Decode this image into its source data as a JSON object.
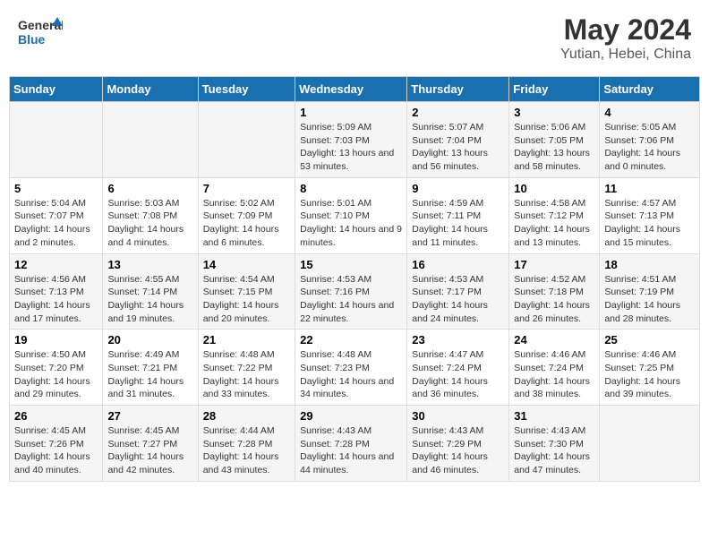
{
  "header": {
    "logo_line1": "General",
    "logo_line2": "Blue",
    "month_year": "May 2024",
    "location": "Yutian, Hebei, China"
  },
  "weekdays": [
    "Sunday",
    "Monday",
    "Tuesday",
    "Wednesday",
    "Thursday",
    "Friday",
    "Saturday"
  ],
  "weeks": [
    [
      {
        "day": "",
        "info": ""
      },
      {
        "day": "",
        "info": ""
      },
      {
        "day": "",
        "info": ""
      },
      {
        "day": "1",
        "info": "Sunrise: 5:09 AM\nSunset: 7:03 PM\nDaylight: 13 hours and 53 minutes."
      },
      {
        "day": "2",
        "info": "Sunrise: 5:07 AM\nSunset: 7:04 PM\nDaylight: 13 hours and 56 minutes."
      },
      {
        "day": "3",
        "info": "Sunrise: 5:06 AM\nSunset: 7:05 PM\nDaylight: 13 hours and 58 minutes."
      },
      {
        "day": "4",
        "info": "Sunrise: 5:05 AM\nSunset: 7:06 PM\nDaylight: 14 hours and 0 minutes."
      }
    ],
    [
      {
        "day": "5",
        "info": "Sunrise: 5:04 AM\nSunset: 7:07 PM\nDaylight: 14 hours and 2 minutes."
      },
      {
        "day": "6",
        "info": "Sunrise: 5:03 AM\nSunset: 7:08 PM\nDaylight: 14 hours and 4 minutes."
      },
      {
        "day": "7",
        "info": "Sunrise: 5:02 AM\nSunset: 7:09 PM\nDaylight: 14 hours and 6 minutes."
      },
      {
        "day": "8",
        "info": "Sunrise: 5:01 AM\nSunset: 7:10 PM\nDaylight: 14 hours and 9 minutes."
      },
      {
        "day": "9",
        "info": "Sunrise: 4:59 AM\nSunset: 7:11 PM\nDaylight: 14 hours and 11 minutes."
      },
      {
        "day": "10",
        "info": "Sunrise: 4:58 AM\nSunset: 7:12 PM\nDaylight: 14 hours and 13 minutes."
      },
      {
        "day": "11",
        "info": "Sunrise: 4:57 AM\nSunset: 7:13 PM\nDaylight: 14 hours and 15 minutes."
      }
    ],
    [
      {
        "day": "12",
        "info": "Sunrise: 4:56 AM\nSunset: 7:13 PM\nDaylight: 14 hours and 17 minutes."
      },
      {
        "day": "13",
        "info": "Sunrise: 4:55 AM\nSunset: 7:14 PM\nDaylight: 14 hours and 19 minutes."
      },
      {
        "day": "14",
        "info": "Sunrise: 4:54 AM\nSunset: 7:15 PM\nDaylight: 14 hours and 20 minutes."
      },
      {
        "day": "15",
        "info": "Sunrise: 4:53 AM\nSunset: 7:16 PM\nDaylight: 14 hours and 22 minutes."
      },
      {
        "day": "16",
        "info": "Sunrise: 4:53 AM\nSunset: 7:17 PM\nDaylight: 14 hours and 24 minutes."
      },
      {
        "day": "17",
        "info": "Sunrise: 4:52 AM\nSunset: 7:18 PM\nDaylight: 14 hours and 26 minutes."
      },
      {
        "day": "18",
        "info": "Sunrise: 4:51 AM\nSunset: 7:19 PM\nDaylight: 14 hours and 28 minutes."
      }
    ],
    [
      {
        "day": "19",
        "info": "Sunrise: 4:50 AM\nSunset: 7:20 PM\nDaylight: 14 hours and 29 minutes."
      },
      {
        "day": "20",
        "info": "Sunrise: 4:49 AM\nSunset: 7:21 PM\nDaylight: 14 hours and 31 minutes."
      },
      {
        "day": "21",
        "info": "Sunrise: 4:48 AM\nSunset: 7:22 PM\nDaylight: 14 hours and 33 minutes."
      },
      {
        "day": "22",
        "info": "Sunrise: 4:48 AM\nSunset: 7:23 PM\nDaylight: 14 hours and 34 minutes."
      },
      {
        "day": "23",
        "info": "Sunrise: 4:47 AM\nSunset: 7:24 PM\nDaylight: 14 hours and 36 minutes."
      },
      {
        "day": "24",
        "info": "Sunrise: 4:46 AM\nSunset: 7:24 PM\nDaylight: 14 hours and 38 minutes."
      },
      {
        "day": "25",
        "info": "Sunrise: 4:46 AM\nSunset: 7:25 PM\nDaylight: 14 hours and 39 minutes."
      }
    ],
    [
      {
        "day": "26",
        "info": "Sunrise: 4:45 AM\nSunset: 7:26 PM\nDaylight: 14 hours and 40 minutes."
      },
      {
        "day": "27",
        "info": "Sunrise: 4:45 AM\nSunset: 7:27 PM\nDaylight: 14 hours and 42 minutes."
      },
      {
        "day": "28",
        "info": "Sunrise: 4:44 AM\nSunset: 7:28 PM\nDaylight: 14 hours and 43 minutes."
      },
      {
        "day": "29",
        "info": "Sunrise: 4:43 AM\nSunset: 7:28 PM\nDaylight: 14 hours and 44 minutes."
      },
      {
        "day": "30",
        "info": "Sunrise: 4:43 AM\nSunset: 7:29 PM\nDaylight: 14 hours and 46 minutes."
      },
      {
        "day": "31",
        "info": "Sunrise: 4:43 AM\nSunset: 7:30 PM\nDaylight: 14 hours and 47 minutes."
      },
      {
        "day": "",
        "info": ""
      }
    ]
  ]
}
